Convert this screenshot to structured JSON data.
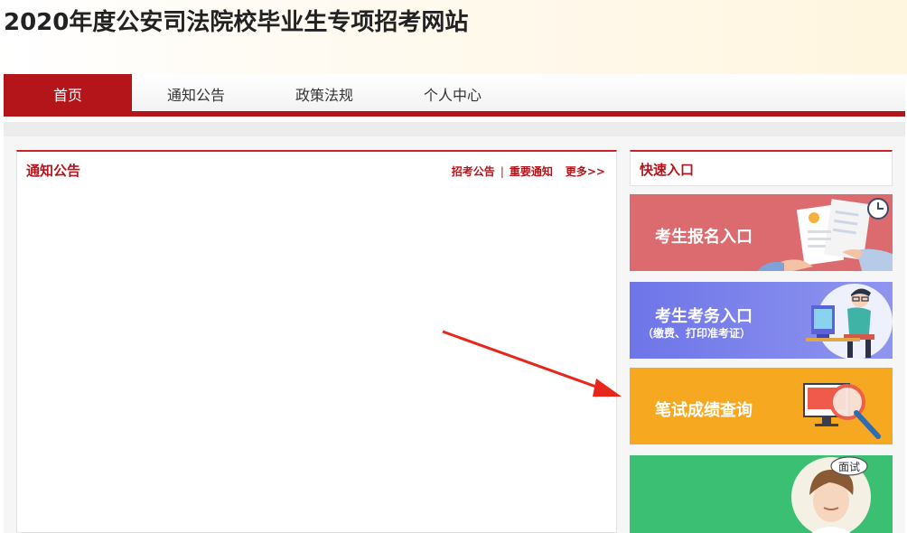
{
  "header": {
    "title": "2020年度公安司法院校毕业生专项招考网站"
  },
  "nav": {
    "items": [
      {
        "label": "首页",
        "active": true
      },
      {
        "label": "通知公告",
        "active": false
      },
      {
        "label": "政策法规",
        "active": false
      },
      {
        "label": "个人中心",
        "active": false
      }
    ]
  },
  "notice": {
    "title": "通知公告",
    "link_exam": "招考公告",
    "separator": "|",
    "link_important": "重要通知",
    "more": "更多>>"
  },
  "quick": {
    "title": "快速入口",
    "cards": [
      {
        "label": "考生报名入口",
        "icon": "registration-form-icon",
        "color": "#dc6b6f"
      },
      {
        "label": "考生考务入口",
        "sub": "（缴费、打印准考证）",
        "icon": "student-computer-icon",
        "color": "#7a80eb"
      },
      {
        "label": "笔试成绩查询",
        "icon": "magnifier-monitor-icon",
        "color": "#f6a920"
      },
      {
        "label": "",
        "badge": "面试",
        "icon": "interview-person-icon",
        "color": "#3bbf72"
      }
    ]
  },
  "colors": {
    "brand_red": "#b3151b",
    "annotation_arrow": "#e8271c"
  }
}
